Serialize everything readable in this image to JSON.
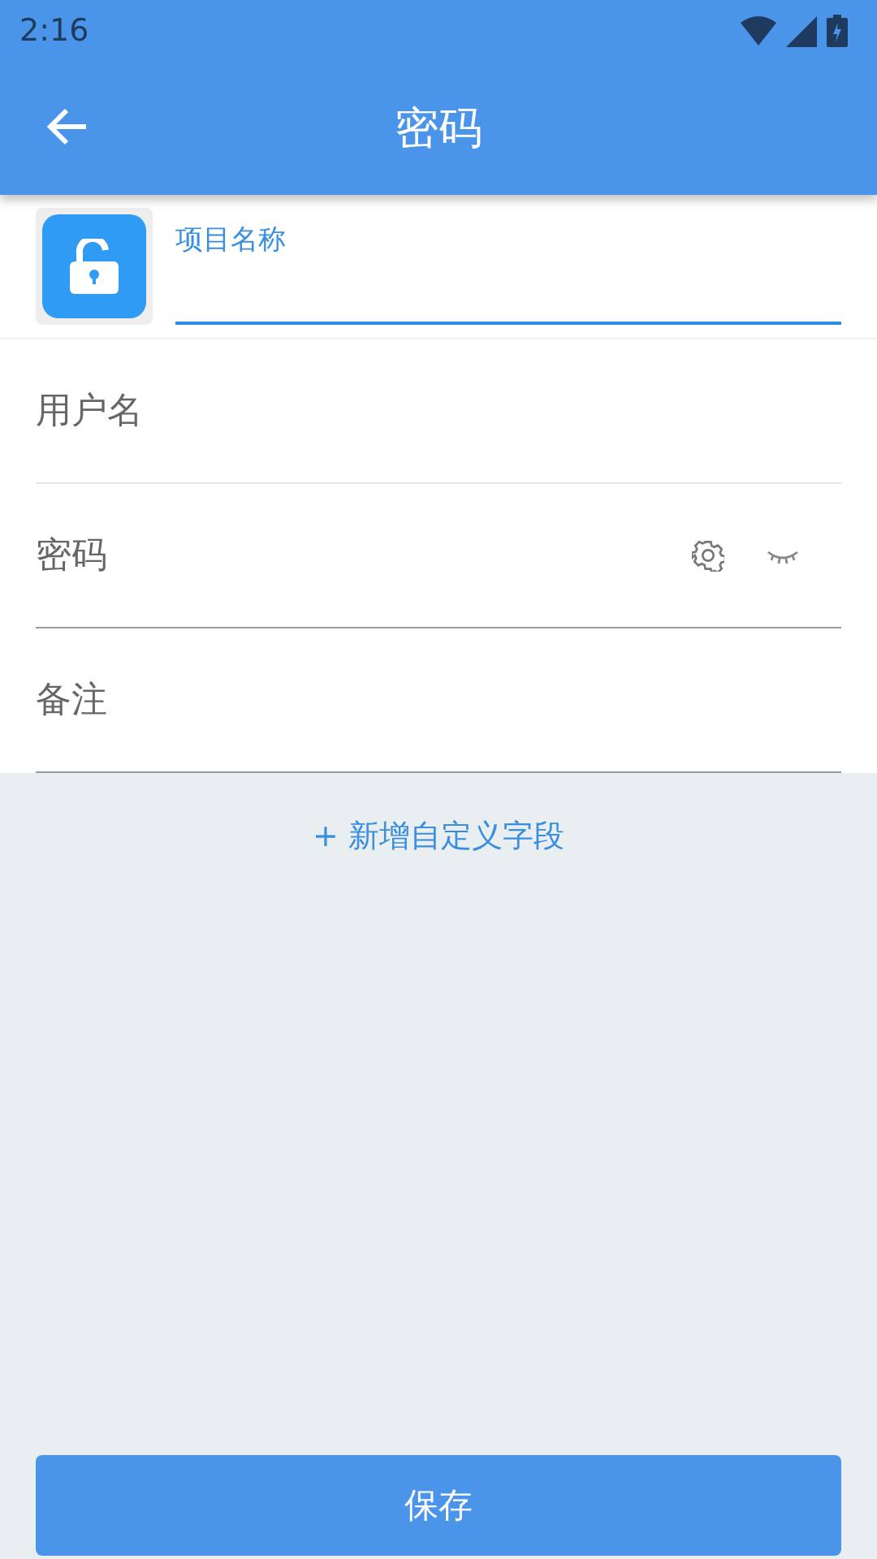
{
  "status_bar": {
    "time": "2:16"
  },
  "app_bar": {
    "title": "密码"
  },
  "item_name": {
    "label": "项目名称",
    "focused": true
  },
  "fields": [
    {
      "placeholder": "用户名",
      "kind": "plain"
    },
    {
      "placeholder": "密码",
      "kind": "password"
    },
    {
      "placeholder": "备注",
      "kind": "underlined"
    }
  ],
  "add_field": {
    "label": "+ 新增自定义字段"
  },
  "save_button": {
    "label": "保存"
  }
}
